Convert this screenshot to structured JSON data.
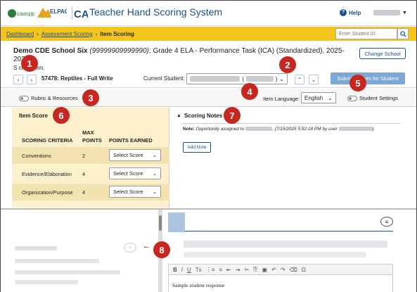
{
  "header": {
    "app_title": "Teacher Hand Scoring System",
    "help_label": "Help",
    "logos": [
      "caaspp-logo",
      "elpac-logo",
      "ca-logo"
    ]
  },
  "breadcrumb": {
    "items": [
      "Dashboard",
      "Assessment Scoring",
      "Item Scoring"
    ],
    "separator": "›"
  },
  "search": {
    "placeholder": "Enter Student ID"
  },
  "test": {
    "school": "Demo CDE School Six",
    "school_code": "(99999909999990)",
    "description": ": Grade 4 ELA - Performance Task (ICA) (Standardized), 2025-2026",
    "line2": "S   ct an item.",
    "change_school_label": "Change School"
  },
  "nav": {
    "prev_icon": "‹",
    "next_icon": "›",
    "item_name": "57478: Reptiles - Full Write",
    "current_student_label": "Current Student:",
    "submit_label": "Submit Scores for Student"
  },
  "options": {
    "rubric_label": "Rubric & Resources",
    "item_language_label": "Item Language:",
    "language_value": "English",
    "student_settings_label": "Student Settings"
  },
  "item_score": {
    "title": "Item Score",
    "headers": {
      "criteria": "SCORING CRITERIA",
      "max1": "MAX",
      "max2": "POINTS",
      "earned": "POINTS EARNED"
    },
    "rows": [
      {
        "criteria": "Conventions",
        "max": "2",
        "select": "Select Score"
      },
      {
        "criteria": "Evidence/Elaboration",
        "max": "4",
        "select": "Select Score"
      },
      {
        "criteria": "Organization/Purpose",
        "max": "4",
        "select": "Select Score"
      }
    ]
  },
  "notes": {
    "title": "Scoring Notes",
    "note_prefix": "Note:",
    "note_text": "Opportunity assigned to",
    "note_date": ". (7/15/2025 5:52:18 PM by user",
    "note_end": ")",
    "add_note_label": "Add Note"
  },
  "editor": {
    "toolbar": [
      "B",
      "I",
      "U",
      "Tx",
      "⋮≡",
      "≡",
      "⇤",
      "⇥",
      "✂",
      "⎘",
      "▣",
      "↶",
      "↷",
      "⌫",
      "Ω"
    ],
    "sample_text": "Sample student response"
  },
  "callouts": [
    "1",
    "2",
    "3",
    "4",
    "5",
    "6",
    "7",
    "8"
  ],
  "colors": {
    "accent": "#f4c61d",
    "brand": "#1a4f8b",
    "callout": "#c7271f",
    "panel": "#fcf1cc"
  }
}
